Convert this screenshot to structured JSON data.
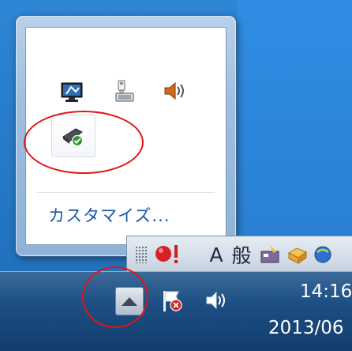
{
  "overflow_panel": {
    "icons": [
      {
        "icon": "display-settings-icon"
      },
      {
        "icon": "network-icon"
      },
      {
        "icon": "volume-icon"
      },
      {
        "icon": "usb-safely-remove-icon"
      }
    ],
    "customize_label": "カスタマイズ..."
  },
  "language_bar": {
    "input_mode_label": "A",
    "ime_label": "般"
  },
  "taskbar": {
    "show_hidden_icons": "chevron-up-icon",
    "clock": {
      "time": "14:16",
      "date": "2013/06"
    }
  },
  "colors": {
    "link": "#1a56a8",
    "annotation": "#e01515",
    "taskbar": "#1d4f84"
  }
}
